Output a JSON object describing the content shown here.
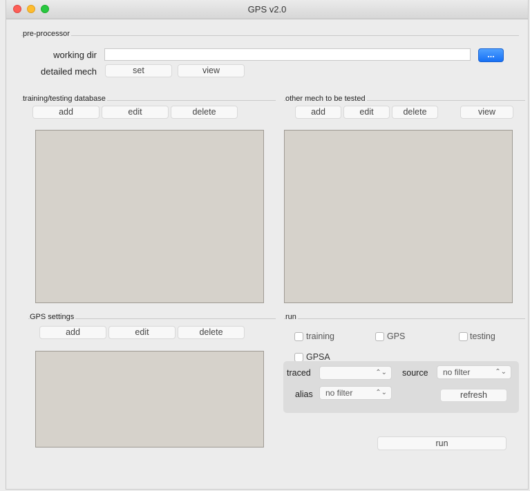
{
  "window": {
    "title": "GPS v2.0"
  },
  "preprocessor": {
    "group_label": "pre-processor",
    "working_dir_label": "working dir",
    "working_dir_value": "",
    "browse_label": "...",
    "detailed_mech_label": "detailed mech",
    "set_label": "set",
    "view_label": "view"
  },
  "training": {
    "group_label": "training/testing database",
    "add_label": "add",
    "edit_label": "edit",
    "delete_label": "delete"
  },
  "other_mech": {
    "group_label": "other mech to be tested",
    "add_label": "add",
    "edit_label": "edit",
    "delete_label": "delete",
    "view_label": "view"
  },
  "gps_settings": {
    "group_label": "GPS settings",
    "add_label": "add",
    "edit_label": "edit",
    "delete_label": "delete"
  },
  "run": {
    "group_label": "run",
    "checkbox_training": "training",
    "checkbox_gps": "GPS",
    "checkbox_testing": "testing",
    "checkbox_gpsa": "GPSA",
    "traced_label": "traced",
    "traced_value": "",
    "source_label": "source",
    "source_value": "no filter",
    "alias_label": "alias",
    "alias_value": "no filter",
    "refresh_label": "refresh",
    "run_label": "run"
  }
}
